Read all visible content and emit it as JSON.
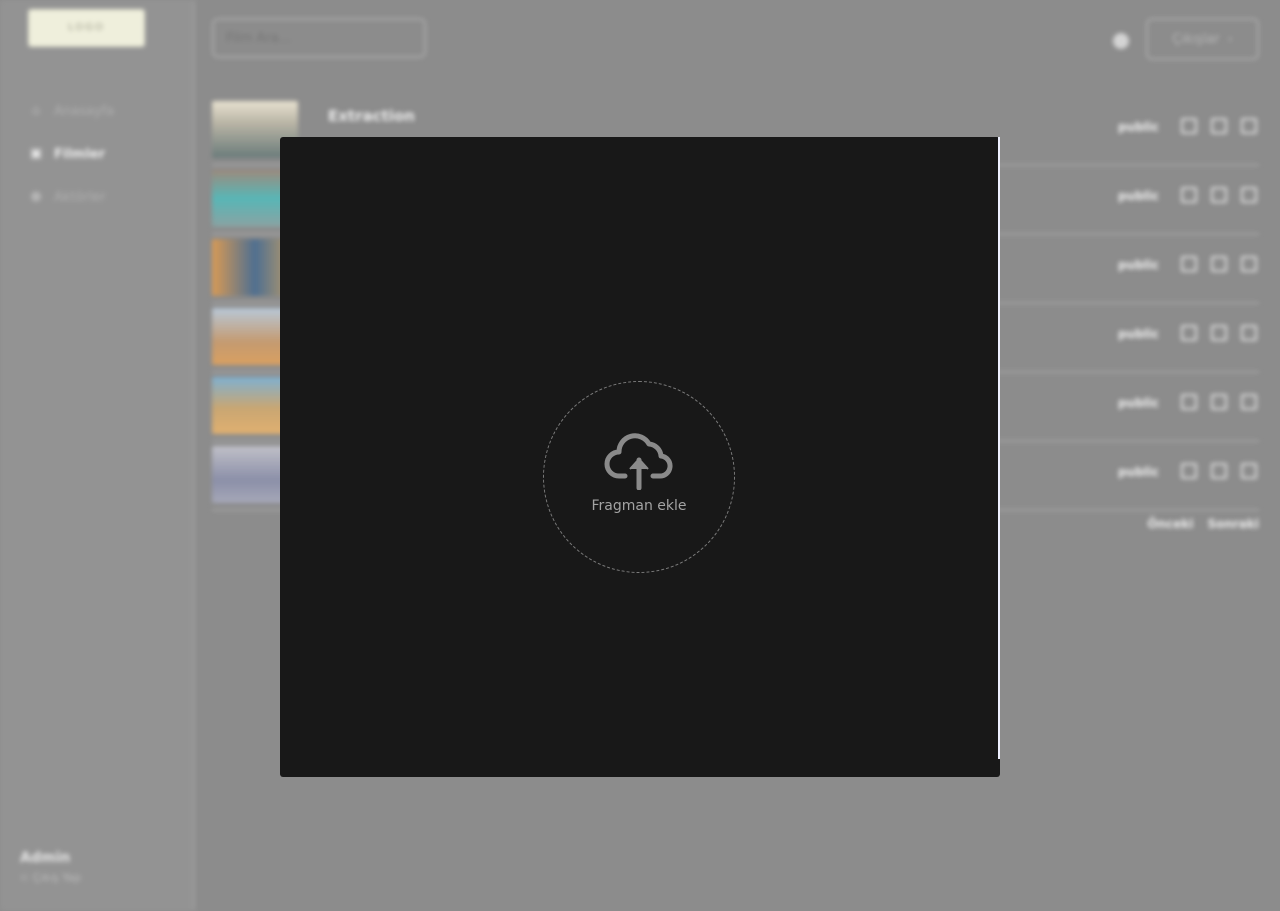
{
  "sidebar": {
    "logo": "LOGO",
    "items": [
      {
        "label": "Anasayfa",
        "icon": "home-icon"
      },
      {
        "label": "Filmler",
        "icon": "film-icon"
      },
      {
        "label": "Aktörler",
        "icon": "user-icon"
      }
    ],
    "user": {
      "name": "Admin",
      "action": "⊂ Çıkış Yap"
    }
  },
  "header": {
    "search_placeholder": "Film Ara...",
    "logout_label": "Çıkışlar"
  },
  "films": [
    {
      "title": "Extraction",
      "status": "public"
    },
    {
      "title": "",
      "status": "public"
    },
    {
      "title": "",
      "status": "public"
    },
    {
      "title": "",
      "status": "public"
    },
    {
      "title": "",
      "status": "public"
    },
    {
      "title": "",
      "status": "public"
    }
  ],
  "pagination": {
    "prev": "Önceki",
    "next": "Sonraki"
  },
  "modal": {
    "upload_label": "Fragman ekle",
    "upload_icon": "cloud-upload-icon"
  },
  "colors": {
    "overlay_bg": "#8c8c8c",
    "modal_bg": "#181818",
    "upload_icon": "#8a8a8a"
  }
}
